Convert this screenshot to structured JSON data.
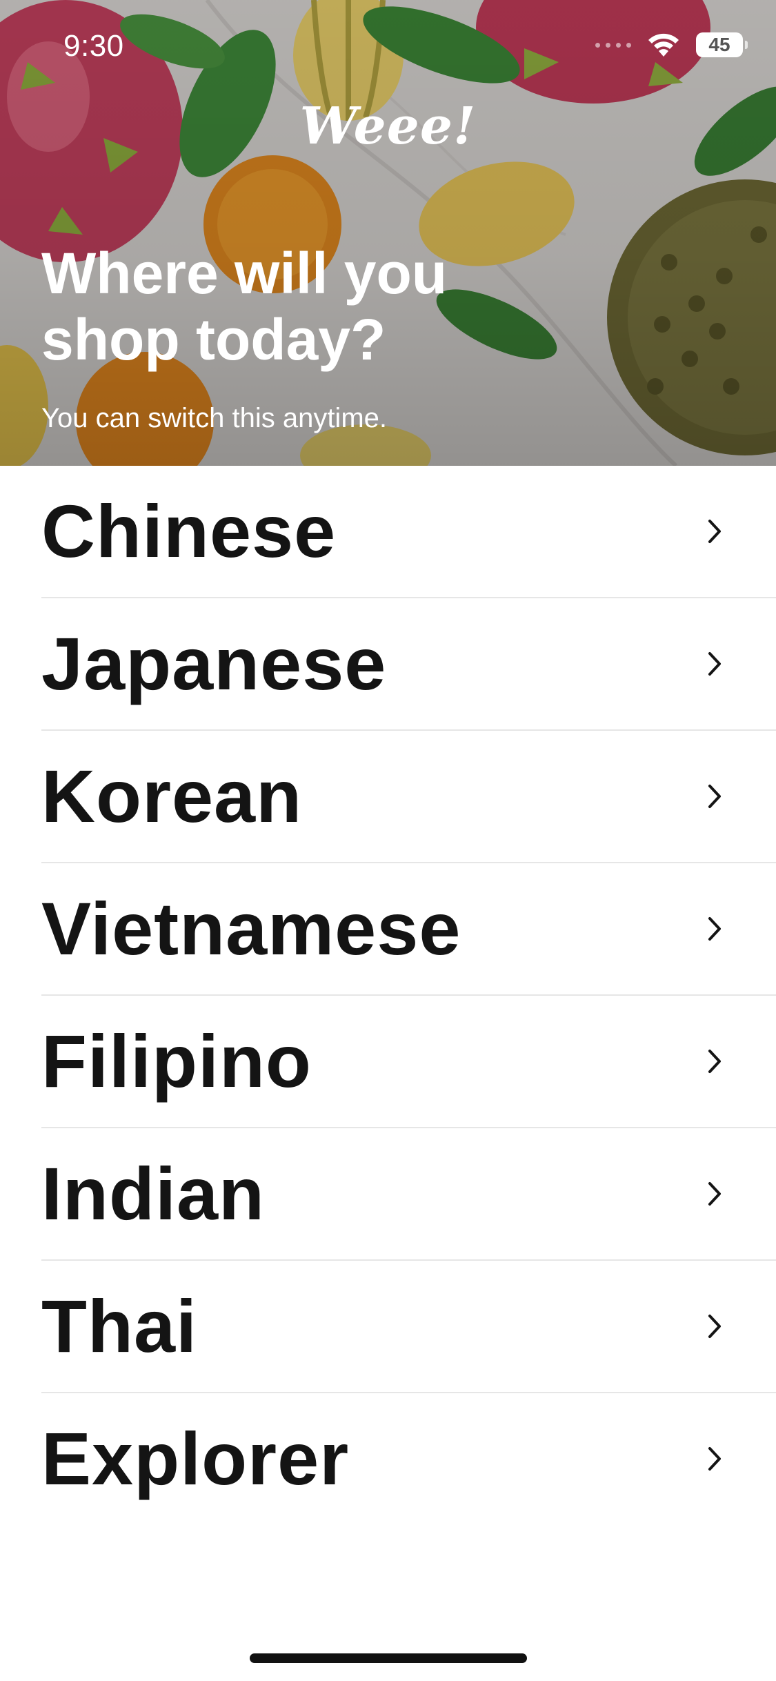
{
  "status_bar": {
    "time": "9:30",
    "battery_level": "45"
  },
  "brand": {
    "logo_text": "Weee!"
  },
  "hero": {
    "title_line1": "Where will you",
    "title_line2": "shop today?",
    "subtitle": "You can switch this anytime."
  },
  "cuisines": [
    {
      "label": "Chinese"
    },
    {
      "label": "Japanese"
    },
    {
      "label": "Korean"
    },
    {
      "label": "Vietnamese"
    },
    {
      "label": "Filipino"
    },
    {
      "label": "Indian"
    },
    {
      "label": "Thai"
    },
    {
      "label": "Explorer"
    }
  ],
  "icons": {
    "row_chevron": "chevron-right-icon",
    "wifi": "wifi-icon",
    "battery": "battery-icon"
  },
  "colors": {
    "text_primary": "#141414",
    "divider": "#e6e6e6",
    "hero_text": "#ffffff"
  }
}
